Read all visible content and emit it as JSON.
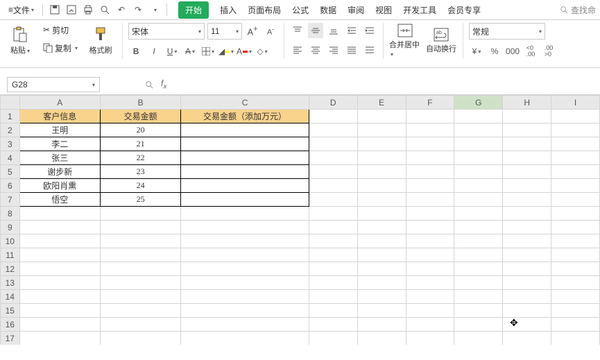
{
  "topbar": {
    "file_label": "文件",
    "tabs": [
      "开始",
      "插入",
      "页面布局",
      "公式",
      "数据",
      "审阅",
      "视图",
      "开发工具",
      "会员专享"
    ],
    "active_index": 0,
    "search_label": "查找命"
  },
  "ribbon": {
    "paste_label": "粘贴",
    "cut_label": "剪切",
    "copy_label": "复制",
    "format_painter_label": "格式刷",
    "font_name": "宋体",
    "font_size": "11",
    "merge_center_label": "合并居中",
    "wrap_label": "自动换行",
    "number_format": "常规",
    "bold": "B",
    "italic": "I",
    "underline": "U",
    "currency": "¥",
    "percent": "%",
    "thousand": "000",
    "dec_inc": "←0\n.00",
    "dec_dec": ".00\n→0"
  },
  "namebox": {
    "cell_ref": "G28"
  },
  "formula_bar": {
    "value": ""
  },
  "columns": [
    "A",
    "B",
    "C",
    "D",
    "E",
    "F",
    "G",
    "H",
    "I"
  ],
  "selected_col": "G",
  "row_count": 17,
  "data": {
    "headers": [
      "客户信息",
      "交易金额",
      "交易金额（添加万元）"
    ],
    "rows": [
      {
        "a": "王明",
        "b": "20",
        "c": ""
      },
      {
        "a": "李二",
        "b": "21",
        "c": ""
      },
      {
        "a": "张三",
        "b": "22",
        "c": ""
      },
      {
        "a": "谢步新",
        "b": "23",
        "c": ""
      },
      {
        "a": "欧阳肖熏",
        "b": "24",
        "c": ""
      },
      {
        "a": "悟空",
        "b": "25",
        "c": ""
      }
    ]
  }
}
